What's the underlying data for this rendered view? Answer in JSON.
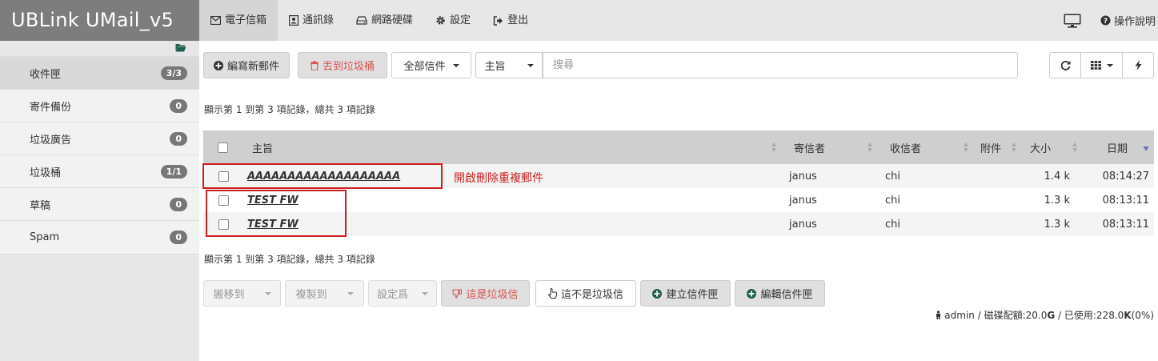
{
  "app": {
    "title": "UBLink UMail_v5"
  },
  "nav": {
    "items": [
      {
        "label": "電子信箱",
        "icon": "envelope-icon"
      },
      {
        "label": "通訊錄",
        "icon": "address-book-icon"
      },
      {
        "label": "網路硬碟",
        "icon": "hdd-icon"
      },
      {
        "label": "設定",
        "icon": "gear-icon"
      },
      {
        "label": "登出",
        "icon": "sign-out-icon"
      }
    ],
    "help_label": "操作說明"
  },
  "sidebar": {
    "folders": [
      {
        "label": "收件匣",
        "count": "3/3"
      },
      {
        "label": "寄件備份",
        "count": "0"
      },
      {
        "label": "垃圾廣告",
        "count": "0"
      },
      {
        "label": "垃圾桶",
        "count": "1/1"
      },
      {
        "label": "草稿",
        "count": "0"
      },
      {
        "label": "Spam",
        "count": "0"
      }
    ]
  },
  "toolbar": {
    "compose_label": "編寫新郵件",
    "trash_label": "丟到垃圾桶",
    "filter_label": "全部信件",
    "field_label": "主旨",
    "search_placeholder": "搜尋"
  },
  "records_info": "顯示第 1 到第 3 項記錄，總共 3 項記錄",
  "table": {
    "headers": {
      "subject": "主旨",
      "sender": "寄信者",
      "recipient": "收信者",
      "attachment": "附件",
      "size": "大小",
      "date": "日期"
    },
    "rows": [
      {
        "subject": "AAAAAAAAAAAAAAAAAAA",
        "sender": "janus",
        "recipient": "chi",
        "size": "1.4 k",
        "date": "08:14:27"
      },
      {
        "subject": "TEST FW",
        "sender": "janus",
        "recipient": "chi",
        "size": "1.3 k",
        "date": "08:13:11"
      },
      {
        "subject": "TEST FW",
        "sender": "janus",
        "recipient": "chi",
        "size": "1.3 k",
        "date": "08:13:11"
      }
    ]
  },
  "annotation": "開啟刪除重複郵件",
  "bottom_toolbar": {
    "move_label": "搬移到",
    "copy_label": "複製到",
    "set_label": "設定爲",
    "spam_label": "這是垃圾信",
    "not_spam_label": "這不是垃圾信",
    "create_folder_label": "建立信件匣",
    "edit_folder_label": "編輯信件匣"
  },
  "footer": {
    "user": "admin",
    "quota_label": "磁碟配額:",
    "quota": "20.0",
    "quota_unit": "G",
    "used_label": "已使用:",
    "used": "228.0",
    "used_unit": "K",
    "percent": "(0%)"
  },
  "colors": {
    "accent_red": "#cc1f1f",
    "brand_bg": "#7d7d7d",
    "badge_bg": "#777777"
  }
}
